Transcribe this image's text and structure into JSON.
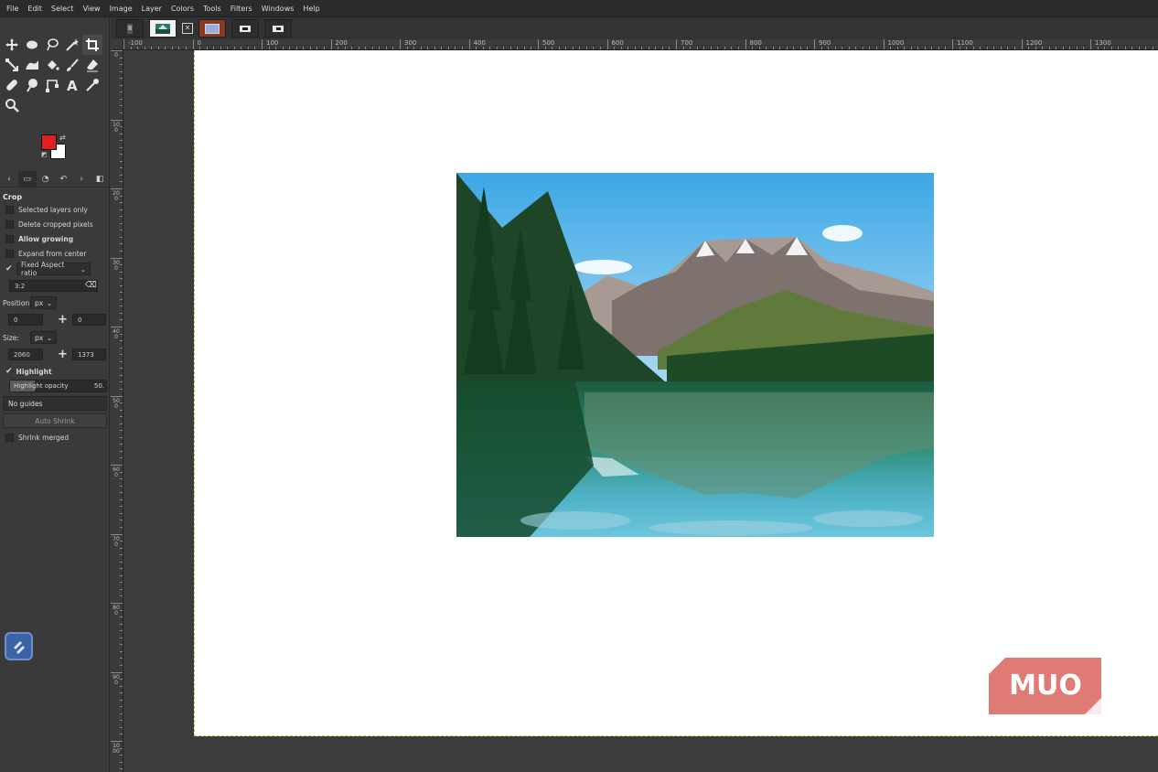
{
  "menu": [
    "File",
    "Edit",
    "Select",
    "View",
    "Image",
    "Layer",
    "Colors",
    "Tools",
    "Filters",
    "Windows",
    "Help"
  ],
  "tool_options": {
    "title": "Crop",
    "selected_layers_only": "Selected layers only",
    "delete_cropped": "Delete cropped pixels",
    "allow_growing": "Allow growing",
    "expand_center": "Expand from center",
    "fixed_label": "Fixed Aspect ratio",
    "ratio_value": "3:2",
    "position_label": "Position:",
    "position_unit": "px",
    "pos_x": "0",
    "pos_y": "0",
    "size_label": "Size:",
    "size_unit": "px",
    "size_w": "2060",
    "size_h": "1373",
    "highlight": "Highlight",
    "highlight_opacity_label": "Highlight opacity",
    "highlight_opacity_value": "50.",
    "highlight_opacity_level": 0.5,
    "guides": "No guides",
    "auto_shrink": "Auto Shrink",
    "shrink_merged": "Shrink merged"
  },
  "ruler": {
    "h_labels": [
      "-100",
      "0",
      "100",
      "200",
      "300",
      "400",
      "500",
      "600",
      "700",
      "800",
      "900",
      "1000",
      "1100",
      "1200",
      "1300"
    ],
    "v_labels": [
      "0",
      "100",
      "200",
      "300",
      "400",
      "500",
      "600",
      "700",
      "800",
      "900",
      "1000"
    ]
  },
  "watermark": "MUO",
  "colors": {
    "foreground": "#e02020",
    "background": "#ffffff",
    "watermark": "#e07a74"
  }
}
